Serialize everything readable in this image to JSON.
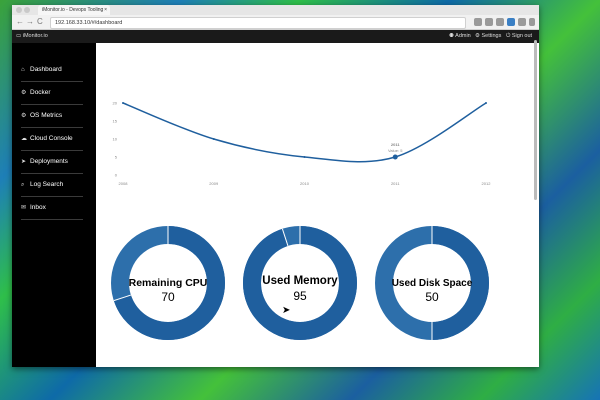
{
  "browser": {
    "tab_title": "iMonitor.io - Devops Tooling",
    "tab_close": "×",
    "url": "192.168.33.10/#/dashboard",
    "nav_back": "←",
    "nav_forward": "→",
    "nav_reload": "C"
  },
  "app": {
    "brand": "iMonitor.io",
    "admin": "Admin",
    "settings": "Settings",
    "signout": "Sign out"
  },
  "sidebar": {
    "items": [
      {
        "label": "Dashboard",
        "icon": "dashboard-icon",
        "glyph": "⌂"
      },
      {
        "label": "Docker",
        "icon": "docker-icon",
        "glyph": "⚙"
      },
      {
        "label": "OS Metrics",
        "icon": "gear-icon",
        "glyph": "⚙"
      },
      {
        "label": "Cloud Console",
        "icon": "cloud-icon",
        "glyph": "☁"
      },
      {
        "label": "Deployments",
        "icon": "send-icon",
        "glyph": "➤"
      },
      {
        "label": "Log Search",
        "icon": "search-icon",
        "glyph": "⌕"
      },
      {
        "label": "Inbox",
        "icon": "envelope-icon",
        "glyph": "✉"
      }
    ]
  },
  "chart_data": {
    "type": "line",
    "x": [
      "2008",
      "2009",
      "2010",
      "2011",
      "2012"
    ],
    "values": [
      20,
      10,
      5,
      5,
      20
    ],
    "yticks": [
      "20",
      "15",
      "10",
      "5",
      "0"
    ],
    "ylim": [
      0,
      20
    ],
    "tooltip": {
      "title": "2011",
      "text": "Value: 5"
    },
    "color": "#1f5f9e"
  },
  "donuts": [
    {
      "label": "Remaining CPU",
      "value": "70",
      "fraction": 0.7
    },
    {
      "label": "Used Memory",
      "value": "95",
      "fraction": 0.95
    },
    {
      "label": "Used Disk Space",
      "value": "50",
      "fraction": 0.5
    }
  ],
  "colors": {
    "donut_dark": "#1f5f9e",
    "donut_light": "#2d6fab",
    "sidebar": "#000000"
  }
}
